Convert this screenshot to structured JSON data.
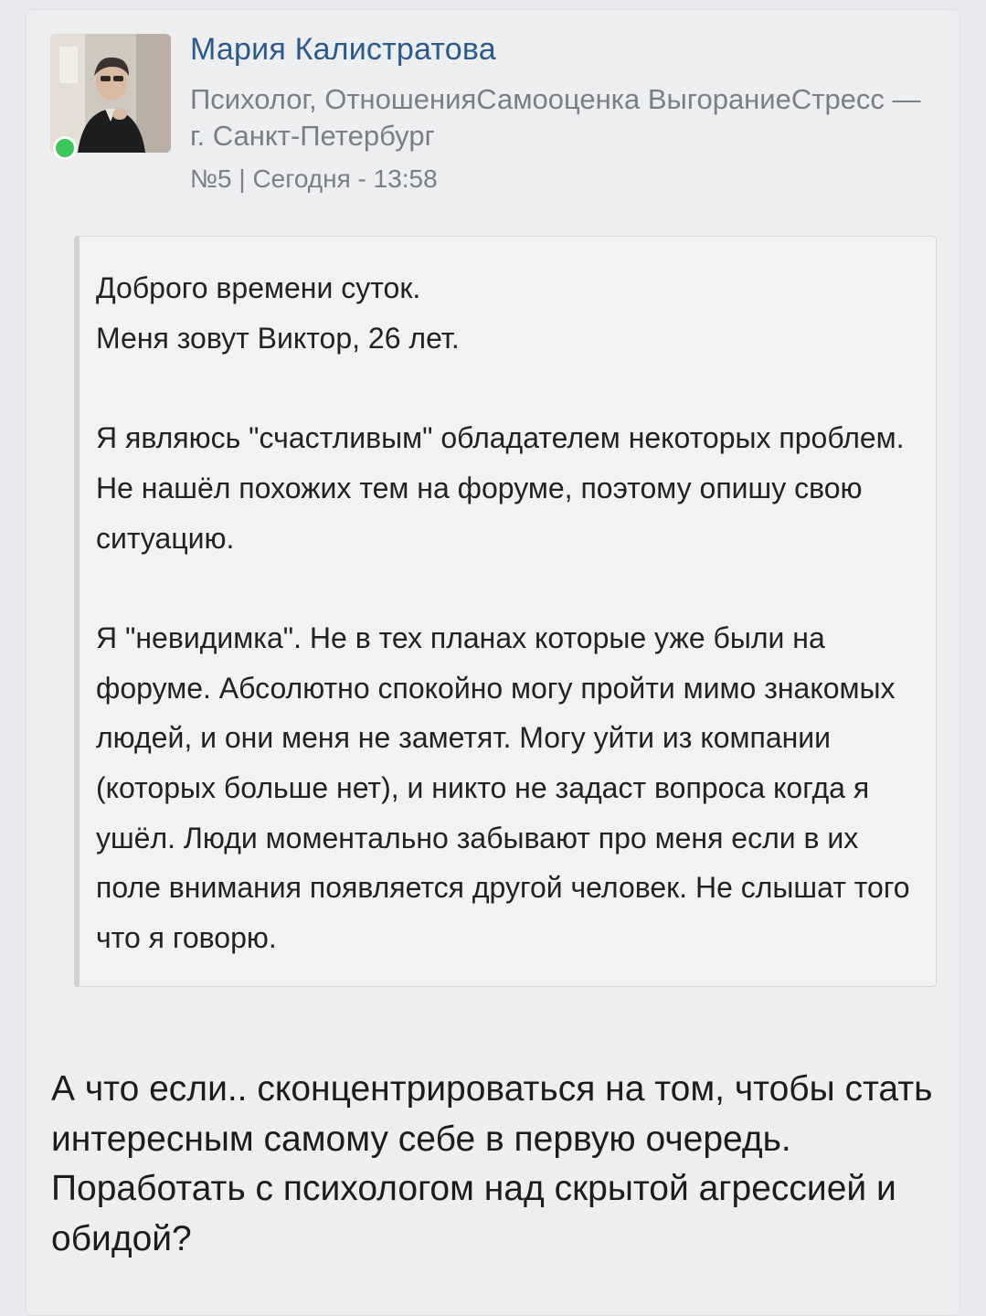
{
  "author": {
    "name": "Мария Калистратова",
    "description": "Психолог, ОтношенияСамооценка ВыгораниеСтресс — г. Санкт-Петербург",
    "online": true
  },
  "post": {
    "meta": "№5 | Сегодня - 13:58"
  },
  "quote": {
    "lines": [
      "Доброго времени суток.",
      "Меня зовут Виктор, 26 лет.",
      "Я являюсь \"счастливым\" обладателем некоторых проблем.",
      "Не нашёл похожих тем на форуме, поэтому опишу свою ситуацию.",
      "Я \"невидимка\". Не в тех планах которые уже были на форуме. Абсолютно спокойно могу пройти мимо знакомых людей, и они меня не заметят. Могу уйти из компании (которых больше нет), и никто не задаст вопроса когда я ушёл. Люди моментально забывают про меня если в их поле внимания появляется другой человек. Не слышат того что я говорю."
    ]
  },
  "reply": {
    "text": "А что если.. сконцентрироваться на том, чтобы стать интересным самому себе в первую очередь. Поработать с психологом над скрытой агрессией и обидой?"
  },
  "colors": {
    "author_name": "#2d5a8c",
    "online_indicator": "#3bc75a",
    "meta_text": "#7b7f85"
  }
}
